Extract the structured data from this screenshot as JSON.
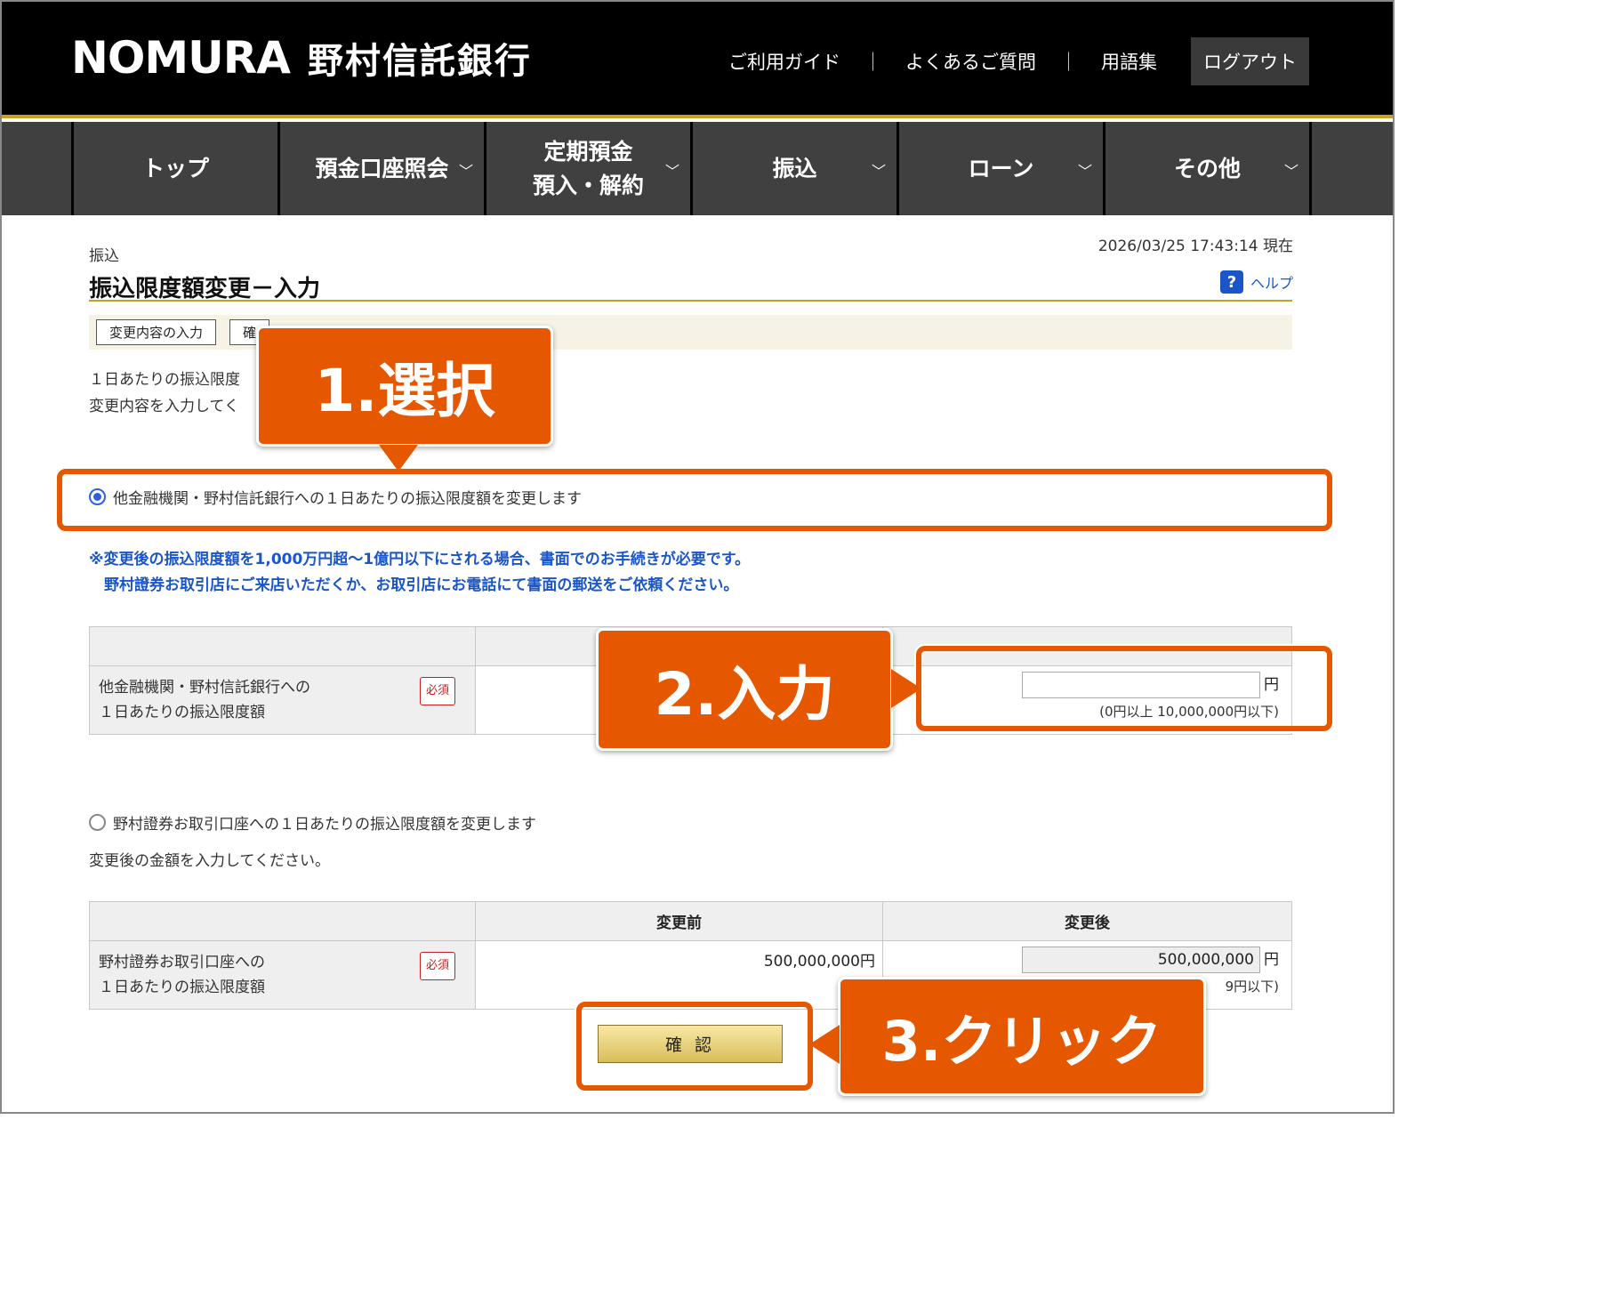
{
  "header": {
    "logo_en": "NOMURA",
    "logo_ja": "野村信託銀行",
    "links": [
      "ご利用ガイド",
      "よくあるご質問",
      "用語集"
    ],
    "separator": "｜",
    "logout": "ログアウト"
  },
  "nav": {
    "items": [
      {
        "label": "トップ"
      },
      {
        "label": "預金口座照会"
      },
      {
        "label1": "定期預金",
        "label2": "預入・解約"
      },
      {
        "label": "振込"
      },
      {
        "label": "ローン"
      },
      {
        "label": "その他"
      }
    ],
    "chevron": "﹀"
  },
  "page": {
    "breadcrumb": "振込",
    "title": "振込限度額変更－入力",
    "timestamp": "2026/03/25  17:43:14 現在",
    "help": "ヘルプ",
    "help_icon": "?"
  },
  "steps": [
    "変更内容の入力",
    "確"
  ],
  "intro": {
    "line1": "１日あたりの振込限度",
    "line2": "変更内容を入力してく"
  },
  "option1": {
    "label": "他金融機関・野村信託銀行への１日あたりの振込限度額を変更します",
    "selected": true
  },
  "notes": {
    "line1": "※変更後の振込限度額を1,000万円超～1億円以下にされる場合、書面でのお手続きが必要です。",
    "line2": "野村證券お取引店にご来店いただくか、お取引店にお電話にて書面の郵送をご依頼ください。"
  },
  "table1": {
    "label_line1": "他金融機関・野村信託銀行への",
    "label_line2": "１日あたりの振込限度額",
    "required": "必須",
    "after_value": "",
    "yen": "円",
    "range": "(0円以上 10,000,000円以下)"
  },
  "option2": {
    "label": "野村證券お取引口座への１日あたりの振込限度額を変更します",
    "selected": false,
    "instruction": "変更後の金額を入力してください。"
  },
  "table2": {
    "col_before": "変更前",
    "col_after": "変更後",
    "label_line1": "野村證券お取引口座への",
    "label_line2": "１日あたりの振込限度額",
    "required": "必須",
    "before_value": "500,000,000円",
    "after_value": "500,000,000",
    "yen": "円",
    "range_tail": "9円以下)"
  },
  "confirm_button": "確 認",
  "annotations": {
    "step1": "1.選択",
    "step2": "2.入力",
    "step3": "3.クリック",
    "color": "#e55800"
  }
}
